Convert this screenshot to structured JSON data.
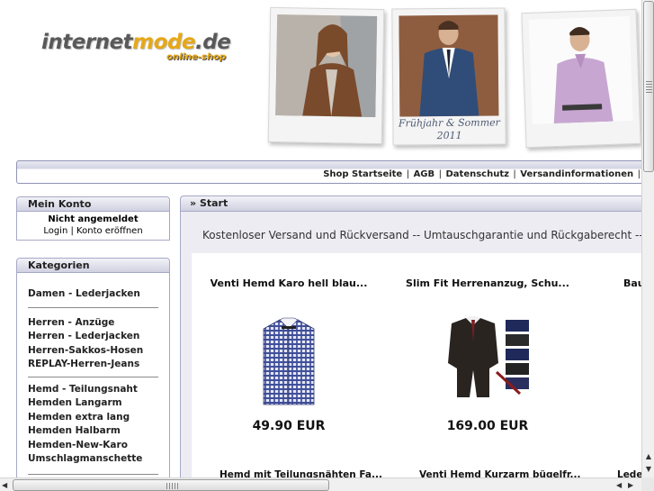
{
  "header": {
    "logo_main": "internet",
    "logo_brand": "mode",
    "logo_tld": ".de",
    "logo_sub": "online-shop",
    "banner_caption_line1": "Frühjahr & Sommer",
    "banner_caption_line2": "2011"
  },
  "topnav": {
    "links": [
      "Shop Startseite",
      "AGB",
      "Datenschutz",
      "Versandinformationen"
    ],
    "separator": "|"
  },
  "account_box": {
    "title": "Mein Konto",
    "status": "Nicht angemeldet",
    "login": "Login",
    "register": "Konto eröffnen",
    "separator": "|"
  },
  "categories_box": {
    "title": "Kategorien",
    "group1": [
      "Damen - Lederjacken"
    ],
    "group2": [
      "Herren - Anzüge",
      "Herren - Lederjacken",
      "Herren-Sakkos-Hosen",
      "REPLAY-Herren-Jeans"
    ],
    "group3": [
      "Hemd - Teilungsnaht",
      "Hemden Langarm",
      "Hemden extra lang",
      "Hemden Halbarm",
      "Hemden-New-Karo",
      "Umschlagmanschette"
    ]
  },
  "main": {
    "breadcrumb_prefix": "»",
    "breadcrumb": "Start",
    "shipping_info": "Kostenloser Versand und Rückversand -- Umtauschgarantie und Rückgaberecht -- T",
    "products": [
      {
        "title": "Venti Hemd Karo hell blau...",
        "price": "49.90 EUR"
      },
      {
        "title": "Slim Fit Herrenanzug, Schu...",
        "price": "169.00 EUR"
      },
      {
        "title": "Bau",
        "price": ""
      }
    ],
    "products_row2": [
      "Hemd mit Teilungsnähten Fa...",
      "Venti Hemd Kurzarm bügelfr...",
      "Leder"
    ]
  },
  "colors": {
    "logo_grey": "#595959",
    "logo_orange": "#e6a817",
    "box_border": "#a6a9c6",
    "panel_bg": "#ececf2"
  },
  "scrollbars": {
    "up_arrow": "▲",
    "down_arrow": "▼",
    "left_arrow": "◀",
    "right_arrow": "▶"
  }
}
